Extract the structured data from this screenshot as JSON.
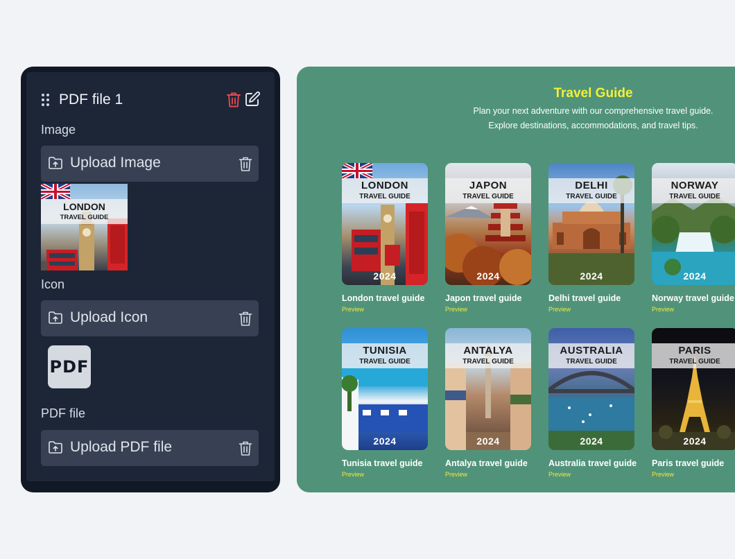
{
  "editor": {
    "title": "PDF file 1",
    "image_label": "Image",
    "upload_image": "Upload Image",
    "thumbnail": {
      "name": "LONDON",
      "sub": "TRAVEL GUIDE"
    },
    "icon_label": "Icon",
    "upload_icon": "Upload Icon",
    "pdf_icon_text": "PDF",
    "pdf_label": "PDF file",
    "upload_pdf": "Upload PDF file"
  },
  "preview": {
    "title": "Travel Guide",
    "subtitle_line1": "Plan your next adventure with our comprehensive travel guide.",
    "subtitle_line2": "Explore destinations, accommodations, and travel tips.",
    "cover_sub": "TRAVEL GUIDE",
    "year": "2024",
    "preview_label": "Preview",
    "guides": [
      {
        "cover": "LONDON",
        "name": "London travel guide"
      },
      {
        "cover": "JAPON",
        "name": "Japon travel guide"
      },
      {
        "cover": "DELHI",
        "name": "Delhi travel guide"
      },
      {
        "cover": "NORWAY",
        "name": "Norway travel guide"
      },
      {
        "cover": "TUNISIA",
        "name": "Tunisia travel guide"
      },
      {
        "cover": "ANTALYA",
        "name": "Antalya travel guide"
      },
      {
        "cover": "AUSTRALIA",
        "name": "Australia travel guide"
      },
      {
        "cover": "PARIS",
        "name": "Paris travel guide"
      }
    ]
  },
  "colors": {
    "accent_yellow": "#f5ef36",
    "delete_red": "#e5484d",
    "preview_bg": "#50937a",
    "editor_bg": "#1d2637"
  }
}
